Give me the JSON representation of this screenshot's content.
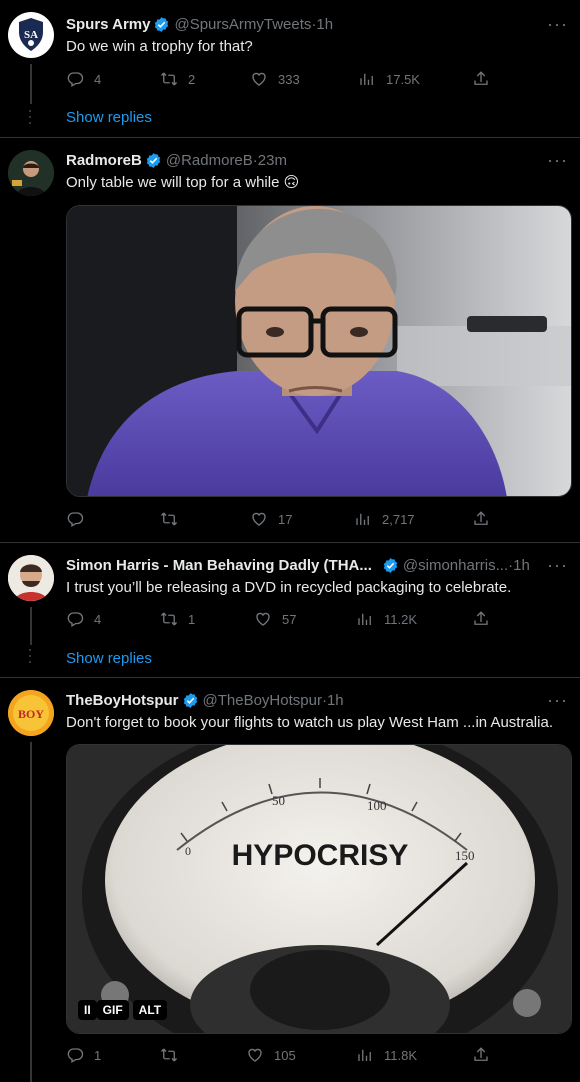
{
  "tweets": [
    {
      "name": "Spurs Army",
      "handle": "@SpursArmyTweets",
      "time": "1h",
      "text": "Do we win a trophy for that?",
      "replies": "4",
      "retweets": "2",
      "likes": "333",
      "views": "17.5K",
      "show_replies": "Show replies",
      "avatar_text": "SA"
    },
    {
      "name": "RadmoreB",
      "handle": "@RadmoreB",
      "time": "23m",
      "text": "Only table we will top for a while 🙃",
      "replies": "",
      "retweets": "",
      "likes": "17",
      "views": "2,717"
    },
    {
      "name": "Simon Harris - Man Behaving Dadly (THA...",
      "handle": "@simonharris...",
      "time": "1h",
      "text": "I trust you’ll be releasing a DVD in recycled packaging to celebrate.",
      "replies": "4",
      "retweets": "1",
      "likes": "57",
      "views": "11.2K",
      "show_replies": "Show replies"
    },
    {
      "name": "TheBoyHotspur",
      "handle": "@TheBoyHotspur",
      "time": "1h",
      "text": "Don't forget to book your flights to watch us play West Ham ...in Australia.",
      "replies": "1",
      "retweets": "",
      "likes": "105",
      "views": "11.8K",
      "avatar_text": "BOY",
      "gauge_word": "HYPOCRISY",
      "gauge_50": "50",
      "gauge_100": "100",
      "gauge_0": "0",
      "gauge_150": "150",
      "gif_label": "GIF",
      "alt_label": "ALT",
      "pause_label": "II"
    }
  ],
  "sep": " · ",
  "more": "···",
  "colors": {
    "accent": "#1d9bf0",
    "muted": "#71767b",
    "bg": "#000000",
    "divider": "#2f3336"
  }
}
